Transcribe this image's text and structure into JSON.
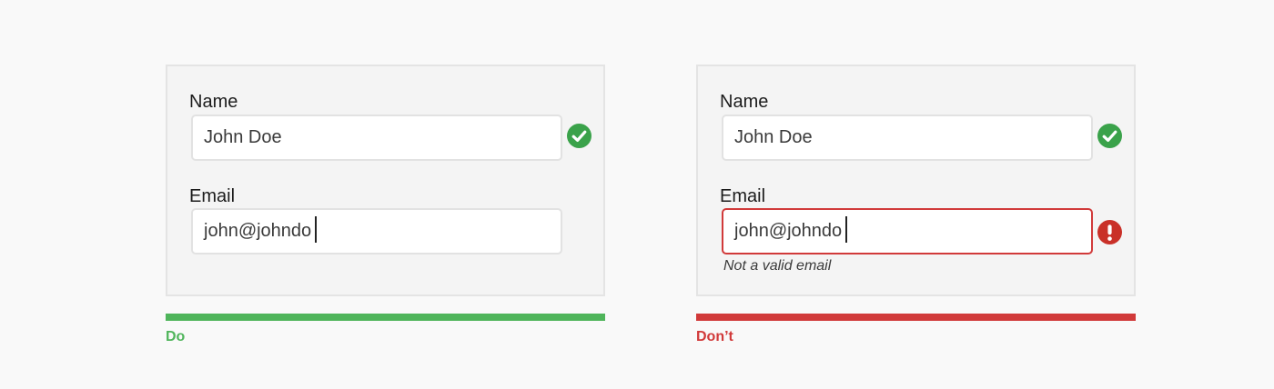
{
  "colors": {
    "do": "#4fb55b",
    "dont": "#d13a3a",
    "success": "#3aa24a",
    "error": "#c93028"
  },
  "examples": {
    "do": {
      "verdict": "Do",
      "name_label": "Name",
      "name_value": "John Doe",
      "name_status_icon": "check-circle-icon",
      "email_label": "Email",
      "email_value": "john@johndo",
      "email_valid": true
    },
    "dont": {
      "verdict": "Don’t",
      "name_label": "Name",
      "name_value": "John Doe",
      "name_status_icon": "check-circle-icon",
      "email_label": "Email",
      "email_value": "john@johndo",
      "email_status_icon": "exclamation-circle-icon",
      "email_error": "Not a valid email",
      "email_valid": false
    }
  }
}
